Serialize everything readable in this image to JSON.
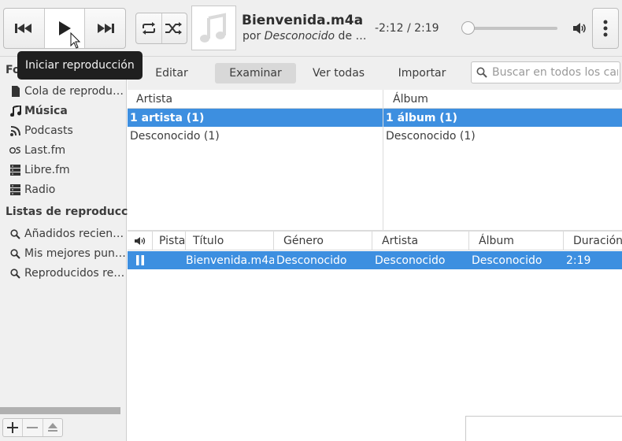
{
  "player": {
    "title": "Bienvenida.m4a",
    "by_prefix": "por ",
    "artist": "Desconocido",
    "album_prefix": " de …",
    "time": "-2:12 / 2:19",
    "progress_fraction": 0.05
  },
  "tooltip": {
    "text": "Iniciar reproducción"
  },
  "sidebar": {
    "sources_header": "Fo",
    "items": [
      {
        "label": "Cola de reproducción",
        "icon": "document-icon"
      },
      {
        "label": "Música",
        "icon": "music-note-icon",
        "bold": true
      },
      {
        "label": "Podcasts",
        "icon": "rss-icon"
      },
      {
        "label": "Last.fm",
        "icon": "lastfm-icon"
      },
      {
        "label": "Libre.fm",
        "icon": "server-icon"
      },
      {
        "label": "Radio",
        "icon": "server-icon"
      }
    ],
    "playlists_header": "Listas de reproducción",
    "playlists": [
      {
        "label": "Añadidos recientemente",
        "icon": "search-icon"
      },
      {
        "label": "Mis mejores puntuaciones",
        "icon": "search-icon"
      },
      {
        "label": "Reproducidos recientemente",
        "icon": "search-icon"
      }
    ]
  },
  "toolbar": {
    "tabs": [
      "Editar",
      "Examinar",
      "Ver todas",
      "Importar"
    ],
    "active_tab": "Examinar",
    "search_placeholder": "Buscar en todos los campos"
  },
  "browser": {
    "artist_header": "Artista",
    "album_header": "Álbum",
    "artist_rows": [
      "1 artista (1)",
      "Desconocido (1)"
    ],
    "album_rows": [
      "1 álbum (1)",
      "Desconocido (1)"
    ]
  },
  "tracks": {
    "headers": [
      "Pista",
      "Título",
      "Género",
      "Artista",
      "Álbum",
      "Duración"
    ],
    "rows": [
      {
        "track": "",
        "title": "Bienvenida.m4a",
        "genre": "Desconocido",
        "artist": "Desconocido",
        "album": "Desconocido",
        "duration": "2:19"
      }
    ]
  },
  "colors": {
    "selection": "#3d8fe0",
    "tooltip_bg": "#1f1f1f"
  }
}
